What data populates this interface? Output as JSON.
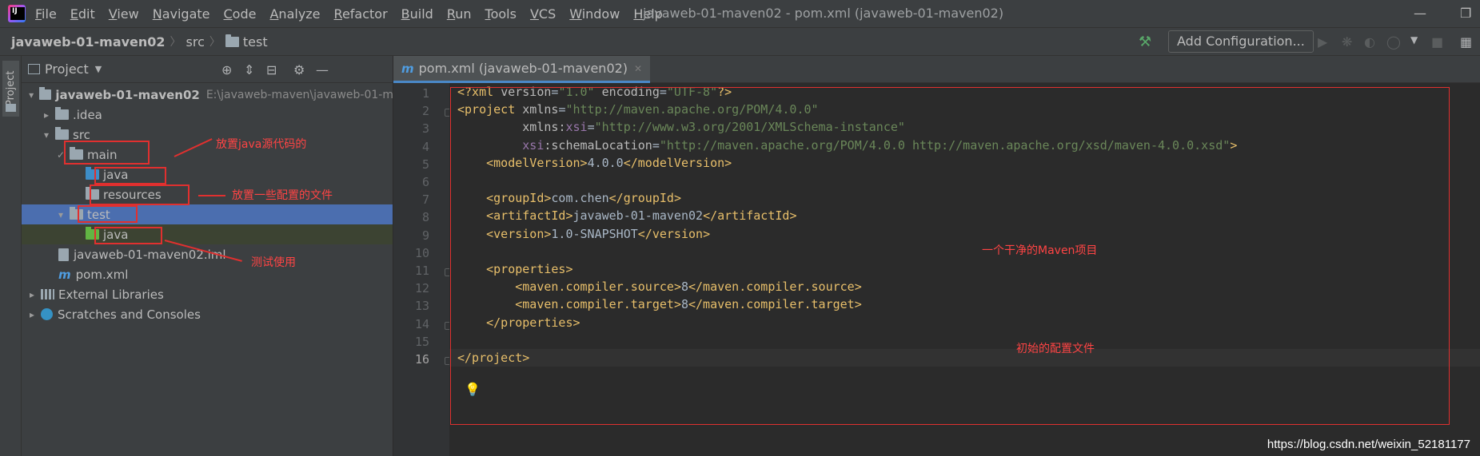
{
  "menubar": {
    "items": [
      "File",
      "Edit",
      "View",
      "Navigate",
      "Code",
      "Analyze",
      "Refactor",
      "Build",
      "Run",
      "Tools",
      "VCS",
      "Window",
      "Help"
    ],
    "window_title": "javaweb-01-maven02 - pom.xml (javaweb-01-maven02)"
  },
  "navbar": {
    "crumbs": [
      "javaweb-01-maven02",
      "src",
      "test"
    ],
    "add_config_label": "Add Configuration..."
  },
  "left_strip": {
    "tab_label": "Project"
  },
  "project_panel": {
    "title": "Project",
    "tree": [
      {
        "label": "javaweb-01-maven02",
        "path": "E:\\javaweb-maven\\javaweb-01-m"
      },
      {
        "label": ".idea"
      },
      {
        "label": "src"
      },
      {
        "label": "main"
      },
      {
        "label": "java"
      },
      {
        "label": "resources"
      },
      {
        "label": "test"
      },
      {
        "label": "java"
      },
      {
        "label": "javaweb-01-maven02.iml"
      },
      {
        "label": "pom.xml"
      },
      {
        "label": "External Libraries"
      },
      {
        "label": "Scratches and Consoles"
      }
    ]
  },
  "annotations": {
    "main": "放置java源代码的",
    "resources": "放置一些配置的文件",
    "test": "测试使用",
    "clean_maven": "一个干净的Maven项目",
    "initial_config": "初始的配置文件"
  },
  "editor": {
    "tab_label": "pom.xml (javaweb-01-maven02)",
    "line_numbers": [
      "1",
      "2",
      "3",
      "4",
      "5",
      "6",
      "7",
      "8",
      "9",
      "10",
      "11",
      "12",
      "13",
      "14",
      "15",
      "16"
    ],
    "lines": [
      "<?xml version=\"1.0\" encoding=\"UTF-8\"?>",
      "<project xmlns=\"http://maven.apache.org/POM/4.0.0\"",
      "         xmlns:xsi=\"http://www.w3.org/2001/XMLSchema-instance\"",
      "         xsi:schemaLocation=\"http://maven.apache.org/POM/4.0.0 http://maven.apache.org/xsd/maven-4.0.0.xsd\">",
      "    <modelVersion>4.0.0</modelVersion>",
      "",
      "    <groupId>com.chen</groupId>",
      "    <artifactId>javaweb-01-maven02</artifactId>",
      "    <version>1.0-SNAPSHOT</version>",
      "",
      "    <properties>",
      "        <maven.compiler.source>8</maven.compiler.source>",
      "        <maven.compiler.target>8</maven.compiler.target>",
      "    </properties>",
      "",
      "</project>"
    ]
  },
  "watermark": "https://blog.csdn.net/weixin_52181177",
  "colors": {
    "tag": "#e8bf6a",
    "attr_value": "#6a8759",
    "attr_name": "#bababa",
    "text": "#a9b7c6",
    "ns": "#9876aa",
    "annotation": "#e0302f",
    "selection": "#4b6eaf"
  }
}
